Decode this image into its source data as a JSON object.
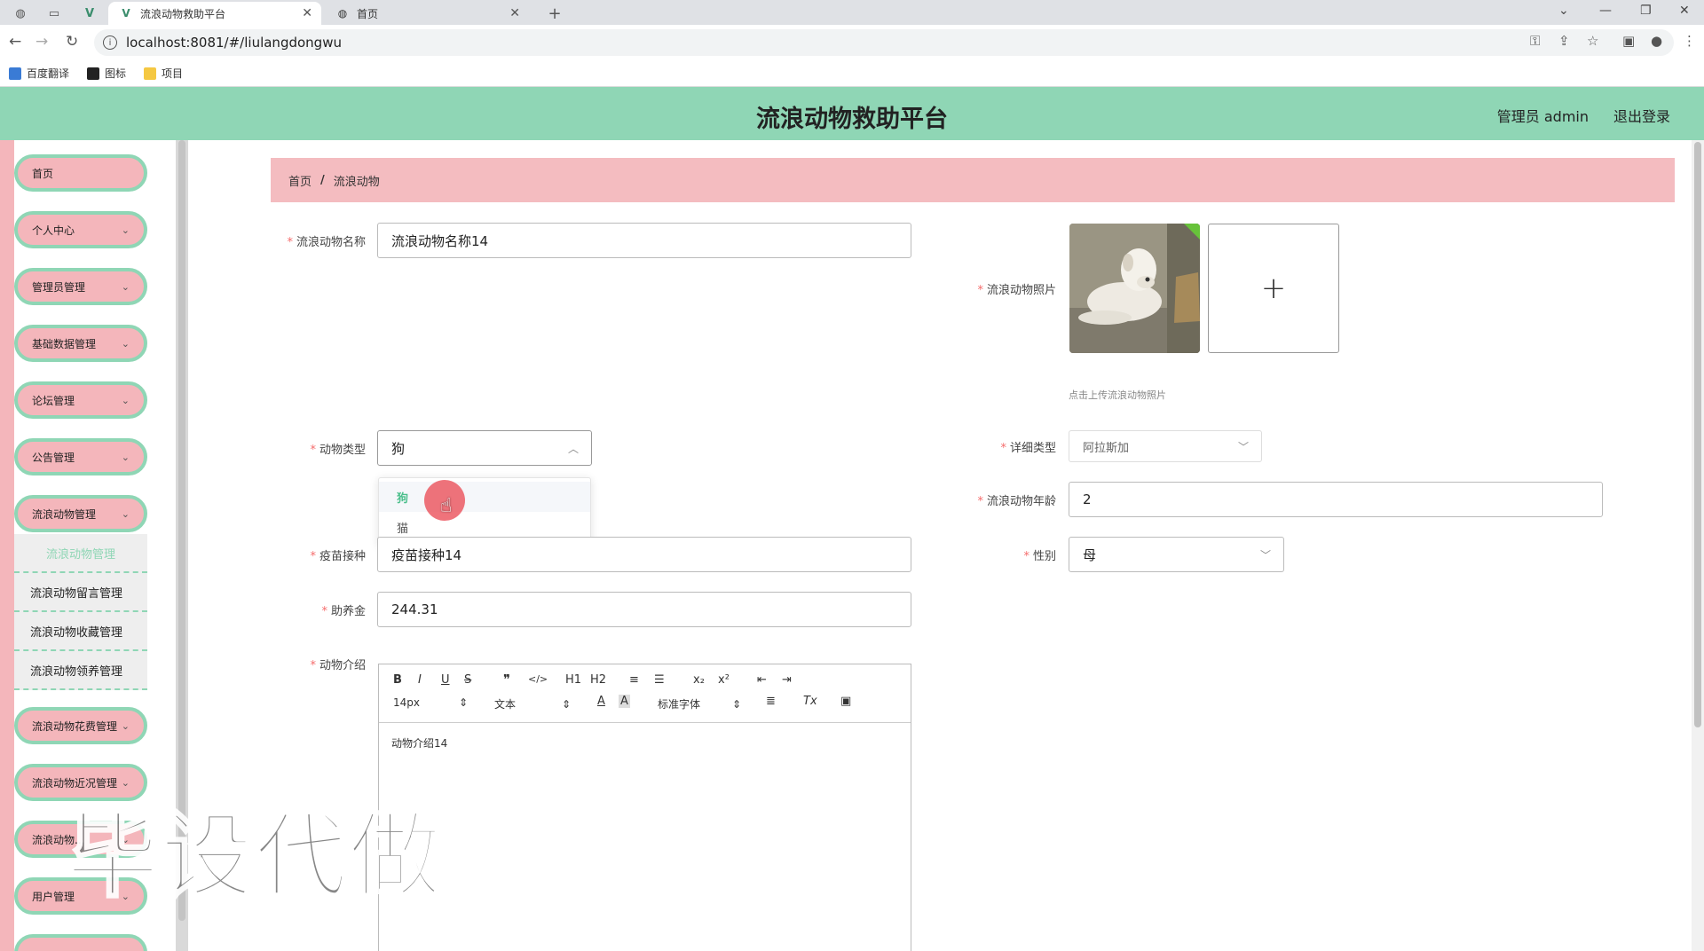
{
  "browser": {
    "tabs": [
      {
        "title": "流浪动物救助平台",
        "active": true
      },
      {
        "title": "首页",
        "active": false
      }
    ],
    "url": "localhost:8081/#/liulangdongwu",
    "bookmarks": [
      "百度翻译",
      "图标",
      "项目"
    ],
    "new_tab": "+"
  },
  "header": {
    "title": "流浪动物救助平台",
    "user": "管理员 admin",
    "logout": "退出登录"
  },
  "sidebar": {
    "items": [
      {
        "label": "首页"
      },
      {
        "label": "个人中心"
      },
      {
        "label": "管理员管理"
      },
      {
        "label": "基础数据管理"
      },
      {
        "label": "论坛管理"
      },
      {
        "label": "公告管理"
      },
      {
        "label": "流浪动物管理"
      },
      {
        "label": "流浪动物花费管理"
      },
      {
        "label": "流浪动物近况管理"
      },
      {
        "label": "流浪动物..."
      },
      {
        "label": "用户管理"
      }
    ],
    "submenu": [
      "流浪动物管理",
      "流浪动物留言管理",
      "流浪动物收藏管理",
      "流浪动物领养管理"
    ]
  },
  "breadcrumb": {
    "home": "首页",
    "sep": "/",
    "current": "流浪动物"
  },
  "form": {
    "name_label": "流浪动物名称",
    "name_value": "流浪动物名称14",
    "photo_label": "流浪动物照片",
    "upload_tip": "点击上传流浪动物照片",
    "type_label": "动物类型",
    "type_value": "狗",
    "type_options": [
      "狗",
      "猫"
    ],
    "detail_type_label": "详细类型",
    "detail_type_value": "阿拉斯加",
    "age_label": "流浪动物年龄",
    "age_value": "2",
    "vaccine_label": "疫苗接种",
    "vaccine_value": "疫苗接种14",
    "gender_label": "性别",
    "gender_value": "母",
    "fee_label": "助养金",
    "fee_value": "244.31",
    "intro_label": "动物介绍",
    "intro_value": "动物介绍14"
  },
  "editor": {
    "font_size": "14px",
    "format": "文本",
    "font": "标准字体",
    "buttons": [
      "B",
      "I",
      "U",
      "S",
      "❞",
      "</>",
      "H1",
      "H2",
      "≡",
      "☰",
      "x₂",
      "x²",
      "⇤",
      "⇥",
      "A",
      "A",
      "≣",
      "Tx",
      "▣"
    ]
  },
  "watermark": "毕设代做",
  "colors": {
    "header": "#8fd6b5",
    "breadcrumb": "#f4bcc0",
    "menu": "#f4b6bb",
    "accent": "#4cbf8c"
  }
}
